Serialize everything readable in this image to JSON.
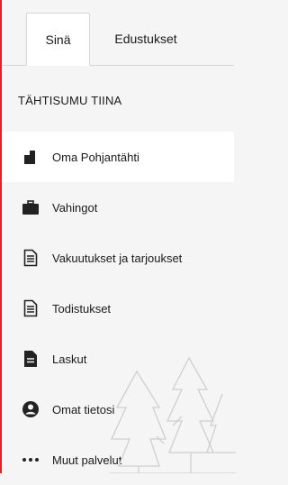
{
  "tabs": [
    {
      "label": "Sinä",
      "active": true
    },
    {
      "label": "Edustukset",
      "active": false
    }
  ],
  "section_title": "TÄHTISUMU TIINA",
  "menu": [
    {
      "label": "Oma Pohjantähti",
      "icon": "home-icon",
      "active": true
    },
    {
      "label": "Vahingot",
      "icon": "briefcase-icon",
      "active": false
    },
    {
      "label": "Vakuutukset ja tarjoukset",
      "icon": "document-icon",
      "active": false
    },
    {
      "label": "Todistukset",
      "icon": "document-icon",
      "active": false
    },
    {
      "label": "Laskut",
      "icon": "invoice-icon",
      "active": false
    },
    {
      "label": "Omat tietosi",
      "icon": "user-icon",
      "active": false
    },
    {
      "label": "Muut palvelut",
      "icon": "more-icon",
      "active": false
    }
  ],
  "colors": {
    "accent": "#e0202b",
    "icon": "#222222",
    "background": "#f5f5f5"
  }
}
